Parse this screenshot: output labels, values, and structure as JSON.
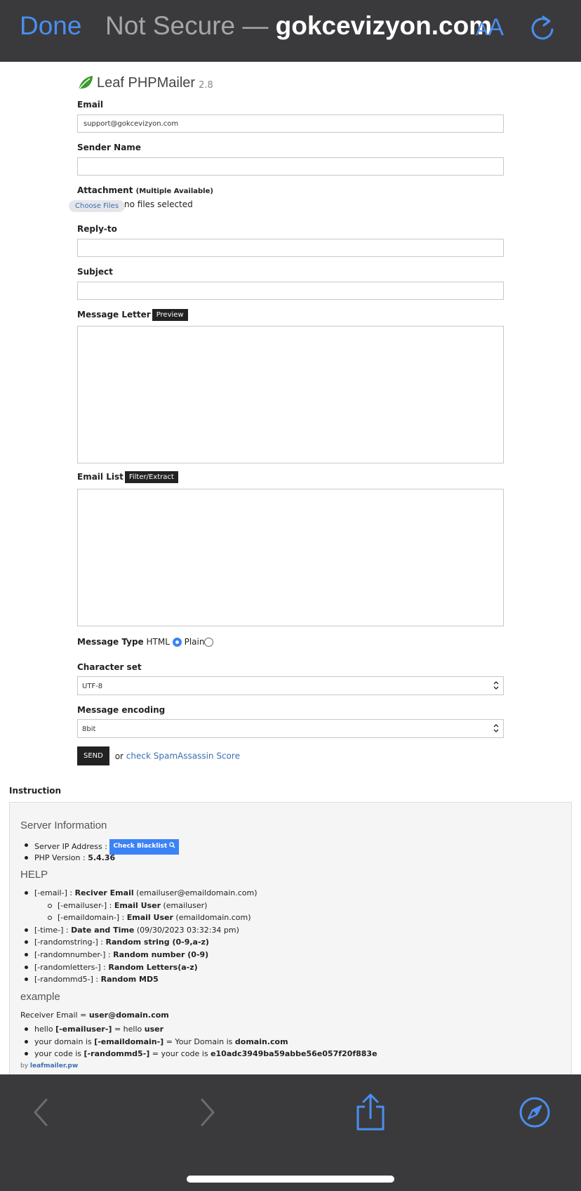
{
  "browser": {
    "done_label": "Done",
    "url_prefix": "Not Secure — ",
    "url_domain": "gokcevizyon.com",
    "aa_small": "A",
    "aa_big": "A"
  },
  "form": {
    "brand_name": "Leaf PHPMailer",
    "brand_version": "2.8",
    "email_label": "Email",
    "email_value": "support@gokcevizyon.com",
    "sender_label": "Sender Name",
    "sender_value": "",
    "attachment_label": "Attachment",
    "attachment_sub": "(Multiple Available)",
    "choose_files": "Choose Files",
    "no_files": "no files selected",
    "reply_label": "Reply-to",
    "subject_label": "Subject",
    "message_label": "Message Letter",
    "preview_btn": "Preview",
    "list_label": "Email List",
    "filter_btn": "Filter/Extract",
    "mtype_label": "Message Type",
    "mtype_html": "HTML",
    "mtype_plain": "Plain",
    "charset_label": "Character set",
    "charset_value": "UTF-8",
    "encoding_label": "Message encoding",
    "encoding_value": "8bit",
    "send_btn": "SEND",
    "or_text": "or",
    "spam_link": "check SpamAssassin Score"
  },
  "instruction": {
    "title": "Instruction",
    "server_heading": "Server Information",
    "ip_label": "Server IP Address :",
    "blacklist_btn": "Check Blacklist",
    "php_label": "PHP Version :",
    "php_value": "5.4.36",
    "help_heading": "HELP",
    "help_items": [
      {
        "tag": "[-email-] :",
        "bold": "Reciver Email",
        "rest": "(emailuser@emaildomain.com)"
      },
      {
        "tag": "[-emailuser-] :",
        "bold": "Email User",
        "rest": "(emailuser)"
      },
      {
        "tag": "[-emaildomain-] :",
        "bold": "Email User",
        "rest": "(emaildomain.com)"
      },
      {
        "tag": "[-time-] :",
        "bold": "Date and Time",
        "rest": "(09/30/2023 03:32:34 pm)"
      },
      {
        "tag": "[-randomstring-] :",
        "bold": "Random string (0-9,a-z)",
        "rest": ""
      },
      {
        "tag": "[-randomnumber-] :",
        "bold": "Random number (0-9)",
        "rest": ""
      },
      {
        "tag": "[-randomletters-] :",
        "bold": "Random Letters(a-z)",
        "rest": ""
      },
      {
        "tag": "[-randommd5-] :",
        "bold": "Random MD5",
        "rest": ""
      }
    ],
    "example_heading": "example",
    "receiver_prefix": "Receiver Email =",
    "receiver_value": "user@domain.com",
    "examples": [
      {
        "a": "hello",
        "b": "[-emailuser-]",
        "c": "= hello",
        "d": "user"
      },
      {
        "a": "your domain is",
        "b": "[-emaildomain-]",
        "c": "= Your Domain is",
        "d": "domain.com"
      },
      {
        "a": "your code is",
        "b": "[-randommd5-]",
        "c": "= your code is",
        "d": "e10adc3949ba59abbe56e057f20f883e"
      }
    ],
    "by_text": "by",
    "by_link": "leafmailer.pw"
  }
}
